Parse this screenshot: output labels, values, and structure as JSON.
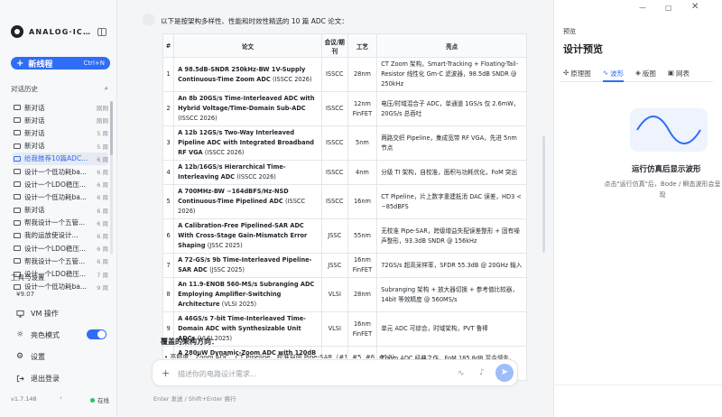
{
  "sidebar": {
    "brand": "ANALOG·IC·...",
    "new_thread": {
      "label": "新线程",
      "shortcut": "Ctrl+N"
    },
    "history_title": "对话历史",
    "items": [
      {
        "title": "新对话",
        "when": "刚刚"
      },
      {
        "title": "新对话",
        "when": "刚刚"
      },
      {
        "title": "新对话",
        "when": "5 周"
      },
      {
        "title": "新对话",
        "when": "5 周"
      },
      {
        "title": "给我推荐10篇ADC...",
        "when": "6 周",
        "active": true
      },
      {
        "title": "设计一个低功耗ba...",
        "when": "6 周"
      },
      {
        "title": "设计一个LDO稳压...",
        "when": "6 周"
      },
      {
        "title": "设计一个低功耗ba...",
        "when": "6 周"
      },
      {
        "title": "新对话",
        "when": "6 周"
      },
      {
        "title": "帮我设计一个五管...",
        "when": "6 周"
      },
      {
        "title": "我的运放使设计...",
        "when": "6 周"
      },
      {
        "title": "设计一个LDO稳压...",
        "when": "6 周"
      },
      {
        "title": "帮我设计一个五管...",
        "when": "6 周"
      },
      {
        "title": "设计一个LDO稳压...",
        "when": "7 周"
      },
      {
        "title": "设计一个低功耗ba...",
        "when": "9 周"
      }
    ],
    "tools_title": "工具与设置",
    "credit": "¥9.07",
    "vm_label": "VM 操作",
    "theme_label": "亮色模式",
    "settings_label": "设置",
    "logout_label": "退出登录",
    "version": "v1.7.148",
    "status": "在线"
  },
  "chat": {
    "intro": "以下是按架构多样性、性能和时效性精选的 10 篇 ADC 论文：",
    "headers": [
      "#",
      "论文",
      "会议/期刊",
      "工艺",
      "亮点"
    ],
    "papers": [
      {
        "n": "1",
        "title": "A 98.5dB-SNDR 250kHz-BW 1V-Supply Continuous-Time Zoom ADC",
        "src": "(ISSCC 2026)",
        "venue": "ISSCC",
        "process": "28nm",
        "highlight": "CT Zoom 架构，Smart-Tracking + Floating-Tail-Resistor 线性化 Gm-C 滤波器，98.5dB SNDR @ 250kHz"
      },
      {
        "n": "2",
        "title": "An 8b 20GS/s Time-Interleaved ADC with Hybrid Voltage/Time-Domain Sub-ADC",
        "src": "(ISSCC 2026)",
        "venue": "ISSCC",
        "process": "12nm FinFET",
        "highlight": "电压/时域混合子 ADC，单通道 1GS/s 仅 2.6mW，20GS/s 总吞吐"
      },
      {
        "n": "3",
        "title": "A 12b 12GS/s Two-Way Interleaved Pipeline ADC with Integrated Broadband RF VGA",
        "src": "(ISSCC 2026)",
        "venue": "ISSCC",
        "process": "5nm",
        "highlight": "两路交织 Pipeline，集成宽带 RF VGA，先进 5nm 节点"
      },
      {
        "n": "4",
        "title": "A 12b/16GS/s Hierarchical Time-Interleaving ADC",
        "src": "(ISSCC 2026)",
        "venue": "ISSCC",
        "process": "4nm",
        "highlight": "分级 TI 架构，自校准，面积与功耗优化，FoM 突出"
      },
      {
        "n": "5",
        "title": "A 700MHz-BW −164dBFS/Hz-NSD Continuous-Time Pipelined ADC",
        "src": "(ISSCC 2026)",
        "venue": "ISSCC",
        "process": "16nm",
        "highlight": "CT Pipeline，片上数字重建抵消 DAC 误差，HD3 < −85dBFS"
      },
      {
        "n": "6",
        "title": "A Calibration-Free Pipelined-SAR ADC With Cross-Stage Gain-Mismatch Error Shaping",
        "src": "(JSSC 2025)",
        "venue": "JSSC",
        "process": "55nm",
        "highlight": "无校准 Pipe-SAR，跨级增益失配误差整形 + 固有噪声整形，93.3dB SNDR @ 156kHz"
      },
      {
        "n": "7",
        "title": "A 72-GS/s 9b Time-Interleaved Pipeline-SAR ADC",
        "src": "(JSSC 2025)",
        "venue": "JSSC",
        "process": "16nm FinFET",
        "highlight": "72GS/s 超高采样率，SFDR 55.3dB @ 20GHz 输入"
      },
      {
        "n": "8",
        "title": "An 11.9-ENOB 560-MS/s Subranging ADC Employing Amplifier-Switching Architecture",
        "src": "(VLSI 2025)",
        "venue": "VLSI",
        "process": "28nm",
        "highlight": "Subranging 架构 + 放大器切换 + 参考值比较器，14bit 等效精度 @ 560MS/s"
      },
      {
        "n": "9",
        "title": "A 46GS/s 7-bit Time-Interleaved Time-Domain ADC with Synthesizable Unit ADCs",
        "src": "(VLSI 2025)",
        "venue": "VLSI",
        "process": "16nm FinFET",
        "highlight": "单元 ADC 可综合，时域架构，PVT 鲁棒"
      },
      {
        "n": "10",
        "title": "A 280μW Dynamic-Zoom ADC with 120dB DR and 118dB SNDR in 1kHz BW",
        "src": "(ISSCC 2018)",
        "venue": "ISSCC",
        "process": "160nm",
        "highlight": "Zoom ADC 经典之作，FoM 185.8dB 至今领先，120dB DR @ 仅 280μW"
      }
    ],
    "section_title": "覆盖的架构方向：",
    "section_line": "• 高精度：Zoom ADC、CT Pipeline、校准自由 Pipe-SAR（#1, #5, #6, #10）",
    "composer_placeholder": "描述你的电路设计需求...",
    "hint": "Enter 发送 / Shift+Enter 换行"
  },
  "right_panel": {
    "label": "预览",
    "title": "设计预览",
    "tabs": [
      {
        "icon": "✣",
        "label": "原理图"
      },
      {
        "icon": "∿",
        "label": "波形",
        "active": true
      },
      {
        "icon": "◈",
        "label": "版图"
      },
      {
        "icon": "▣",
        "label": "网表"
      }
    ],
    "empty_title": "运行仿真后显示波形",
    "empty_desc": "点击\"运行仿真\"后，Bode / 瞬态波形会呈现"
  },
  "colors": {
    "accent": "#2f6df6",
    "online": "#22c55e"
  }
}
